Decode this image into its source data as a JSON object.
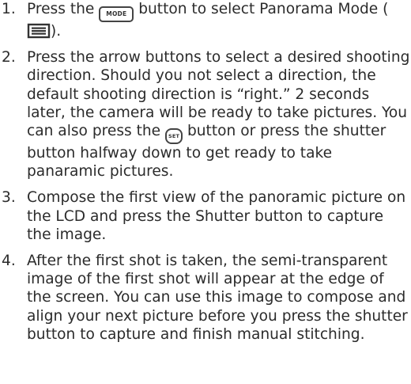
{
  "steps": [
    {
      "number": "1.",
      "text_a": "Press the ",
      "key_label": "MODE",
      "text_b": " button to select Panorama Mode (",
      "icon": "panorama-icon",
      "text_c": ")."
    },
    {
      "number": "2.",
      "text_a": "Press the arrow buttons to select a desired shooting direction. Should you not select a direction, the default shooting direction is “right.” 2 seconds later, the camera will be ready to take pictures. You can also press the ",
      "key_label": "SET",
      "text_b": " button or press the shutter button halfway down to get ready to take panaramic pictures."
    },
    {
      "number": "3.",
      "text": "Compose the first view of the panoramic picture on the LCD and press the Shutter button to capture the image."
    },
    {
      "number": "4.",
      "text": "After the first shot is taken, the semi-transparent image of the first shot will appear at the edge of the screen. You can use this image to compose and align your next picture before you press the shutter button to capture and finish manual stitching."
    }
  ]
}
